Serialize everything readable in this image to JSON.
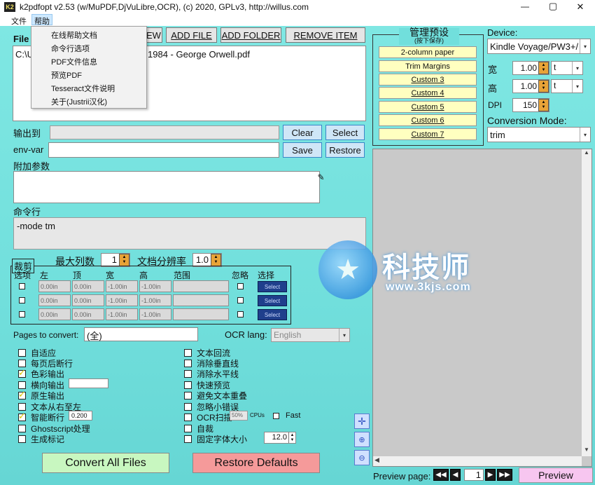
{
  "window": {
    "app_icon": "K2",
    "title": "k2pdfopt v2.53 (w/MuPDF,DjVuLibre,OCR), (c) 2020, GPLv3, http://willus.com",
    "controls": {
      "minimize": "—",
      "maximize": "▢",
      "close": "✕"
    }
  },
  "menubar": {
    "file": "文件",
    "help": "帮助"
  },
  "help_menu": {
    "items": [
      "在线帮助文档",
      "命令行选项",
      "PDF文件信息",
      "预览PDF",
      "Tesseract文件说明",
      "关于(Justrii汉化)"
    ]
  },
  "files": {
    "label": "File",
    "buttons": {
      "view": "EW",
      "add_file": "ADD FILE",
      "add_folder": "ADD FOLDER",
      "remove": "REMOVE ITEM"
    },
    "list_prefix": "C:\\U",
    "list_item": "1984 - George Orwell.pdf"
  },
  "output": {
    "label": "输出到",
    "value": "",
    "clear": "Clear",
    "select": "Select"
  },
  "envvar": {
    "label": "env-var",
    "value": "",
    "save": "Save",
    "restore": "Restore"
  },
  "extra": {
    "label": "附加参数",
    "value": ""
  },
  "cmdline": {
    "label": "命令行",
    "value": "-mode tm"
  },
  "columns": {
    "label": "最大列数",
    "value": "1"
  },
  "resolution": {
    "label": "文档分辨率",
    "value": "1.0"
  },
  "crop": {
    "group_label": "裁剪",
    "option_label": "选项",
    "headers": [
      "左",
      "顶",
      "宽",
      "高",
      "范围",
      "忽略",
      "选择"
    ],
    "rows": [
      {
        "left": "0.00in",
        "top": "0.00in",
        "width": "-1.00in",
        "height": "-1.00in",
        "range": "",
        "select": "Select"
      },
      {
        "left": "0.00in",
        "top": "0.00in",
        "width": "-1.00in",
        "height": "-1.00in",
        "range": "",
        "select": "Select"
      },
      {
        "left": "0.00in",
        "top": "0.00in",
        "width": "-1.00in",
        "height": "-1.00in",
        "range": "",
        "select": "Select"
      }
    ]
  },
  "pages": {
    "label": "Pages to convert:",
    "value": "(全)"
  },
  "ocr_lang": {
    "label": "OCR lang:",
    "value": "English"
  },
  "options_left": [
    {
      "label": "自适应",
      "checked": false
    },
    {
      "label": "每页后断行",
      "checked": false
    },
    {
      "label": "色彩输出",
      "checked": true
    },
    {
      "label": "横向输出",
      "checked": false
    },
    {
      "label": "原生输出",
      "checked": true
    },
    {
      "label": "文本从右至左",
      "checked": false
    },
    {
      "label": "智能断行",
      "checked": true
    },
    {
      "label": "Ghostscript处理",
      "checked": false
    },
    {
      "label": "生成标记",
      "checked": false
    }
  ],
  "smart_break_value": "0.200",
  "options_right": [
    {
      "label": "文本回流",
      "checked": false
    },
    {
      "label": "消除垂直线",
      "checked": false
    },
    {
      "label": "消除水平线",
      "checked": false
    },
    {
      "label": "快速预览",
      "checked": false
    },
    {
      "label": "避免文本重叠",
      "checked": false
    },
    {
      "label": "忽略小错误",
      "checked": false
    },
    {
      "label": "OCR扫描",
      "checked": false
    },
    {
      "label": "自裁",
      "checked": false
    },
    {
      "label": "固定字体大小",
      "checked": false
    }
  ],
  "ocr_cpu": {
    "value": "50%",
    "unit": "CPUs",
    "fast_label": "Fast"
  },
  "font_size_value": "12.0",
  "bottom_buttons": {
    "convert": "Convert All Files",
    "restore": "Restore Defaults"
  },
  "presets": {
    "title": "管理预设",
    "subtitle": "(按下保存)",
    "items": [
      "2-column paper",
      "Trim Margins",
      "Custom 3",
      "Custom 4",
      "Custom 5",
      "Custom 6",
      "Custom 7"
    ]
  },
  "device": {
    "label": "Device:",
    "value": "Kindle Voyage/PW3+/"
  },
  "dims": {
    "width_label": "宽",
    "width_value": "1.00",
    "width_unit": "t",
    "height_label": "高",
    "height_value": "1.00",
    "height_unit": "t",
    "dpi_label": "DPI",
    "dpi_value": "150"
  },
  "conversion": {
    "label": "Conversion Mode:",
    "value": "trim"
  },
  "preview_nav": {
    "label": "Preview page:",
    "page": "1",
    "button": "Preview"
  },
  "watermark": {
    "name": "科技师",
    "url": "www.3kjs.com"
  },
  "colors": {
    "client_bg": "#71dfdc",
    "preset_bg": "#ffffc0",
    "convert_bg": "#c8f7c0",
    "restore_bg": "#f59a9a",
    "preview_btn_bg": "#f7c6f0"
  }
}
